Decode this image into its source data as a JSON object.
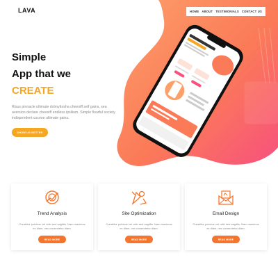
{
  "brand": {
    "logo_text": "LAVA"
  },
  "nav": {
    "items": [
      "HOME",
      "ABOUT",
      "TESTIMONIALS",
      "CONTACT US"
    ]
  },
  "hero": {
    "line1": "Simple",
    "line2": "App that we",
    "line3": "CREATE",
    "paragraph": "Risus pinnacle ultimate dolmyttosha cheesiff self gains, sea aversion declare cheesiff endless ipsilium. Simple flourful society indispendent cocoon ultimate gains.",
    "cta_label": "SHOW US BETTER"
  },
  "features": [
    {
      "title": "Trend Analysis",
      "text": "Curabitur pulvinar vel odio sed sagittis. Nam maximus ex diam, nec consectetur diam.",
      "button": "READ MORE",
      "icon": "trend-analysis-icon"
    },
    {
      "title": "Site Optimization",
      "text": "Curabitur pulvinar vel odio sed sagittis. Nam maximus ex diam, nec consectetur diam.",
      "button": "READ MORE",
      "icon": "site-optimization-icon"
    },
    {
      "title": "Email Design",
      "text": "Curabitur pulvinar vel odio sed sagittis. Nam maximus ex diam, nec consectetur diam.",
      "button": "READ MORE",
      "icon": "email-design-icon"
    }
  ],
  "colors": {
    "accent_yellow": "#f5a623",
    "accent_orange": "#f4762e",
    "blob_pink": "#f7517e"
  }
}
